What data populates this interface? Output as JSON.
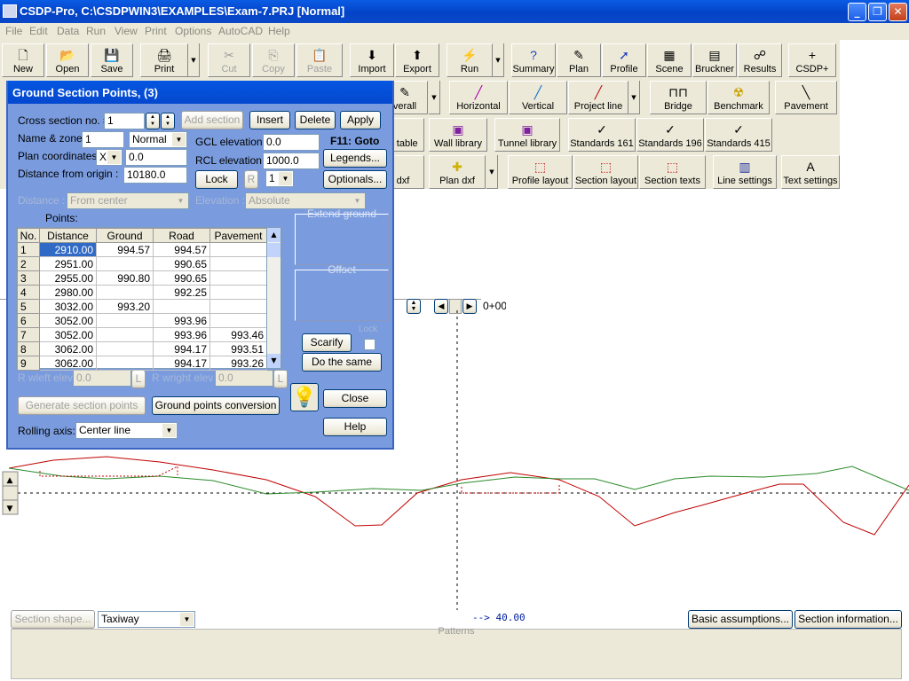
{
  "window": {
    "title": "CSDP-Pro, C:\\CSDPWIN3\\EXAMPLES\\Exam-7.PRJ [Normal]",
    "min": "_",
    "max": "❐",
    "close": "✕"
  },
  "menu": [
    "File",
    "Edit",
    "Data",
    "Run",
    "View",
    "Print",
    "Options",
    "AutoCAD",
    "Help"
  ],
  "toolbar1": [
    {
      "label": "New",
      "icon": "🗋"
    },
    {
      "label": "Open",
      "icon": "📂"
    },
    {
      "label": "Save",
      "icon": "💾"
    },
    {
      "label": "Print",
      "icon": "🖨"
    },
    {
      "label": "Cut",
      "icon": "✂"
    },
    {
      "label": "Copy",
      "icon": "⎘"
    },
    {
      "label": "Paste",
      "icon": "📋"
    },
    {
      "label": "Import",
      "icon": "⬇"
    },
    {
      "label": "Export",
      "icon": "⬆"
    },
    {
      "label": "Run",
      "icon": "⚡"
    },
    {
      "label": "Summary",
      "icon": "?"
    },
    {
      "label": "Plan",
      "icon": "✎"
    },
    {
      "label": "Profile",
      "icon": "➚"
    },
    {
      "label": "Scene",
      "icon": "▦"
    },
    {
      "label": "Bruckner",
      "icon": "▤"
    },
    {
      "label": "Results",
      "icon": "☍"
    },
    {
      "label": "CSDP+",
      "icon": "+"
    }
  ],
  "toolbar2": [
    {
      "label": "verall",
      "icon": "✎"
    },
    {
      "label": "Horizontal",
      "icon": "╱"
    },
    {
      "label": "Vertical",
      "icon": "╱"
    },
    {
      "label": "Project line",
      "icon": "╱"
    },
    {
      "label": "Bridge",
      "icon": "⊓⊓"
    },
    {
      "label": "Benchmark",
      "icon": "☢"
    },
    {
      "label": "Pavement",
      "icon": "╲"
    }
  ],
  "toolbar3": [
    {
      "label": "< table",
      "icon": ""
    },
    {
      "label": "Wall library",
      "icon": "▣"
    },
    {
      "label": "Tunnel library",
      "icon": "▣"
    },
    {
      "label": "Standards 161",
      "icon": "✓"
    },
    {
      "label": "Standards 196",
      "icon": "✓"
    },
    {
      "label": "Standards 415",
      "icon": "✓"
    }
  ],
  "toolbar4": [
    {
      "label": "dxf",
      "icon": ""
    },
    {
      "label": "Plan dxf",
      "icon": "✚"
    },
    {
      "label": "Profile layout",
      "icon": "⬚"
    },
    {
      "label": "Section layout",
      "icon": "⬚"
    },
    {
      "label": "Section texts",
      "icon": "⬚"
    },
    {
      "label": "Line settings",
      "icon": "▥"
    },
    {
      "label": "Text settings",
      "icon": "A"
    }
  ],
  "dialog": {
    "title": "Ground Section Points, (3)",
    "cross_section_label": "Cross section no. #",
    "cross_section_value": "1",
    "add_section": "Add section",
    "insert": "Insert",
    "delete": "Delete",
    "apply": "Apply",
    "name_zone_label": "Name & zone:",
    "name_value": "1",
    "zone_value": "Normal",
    "gcl_label": "GCL elevation :",
    "gcl_value": "0.0",
    "f11": "F11: Goto",
    "plan_coord_label": "Plan coordinates:",
    "plan_axis": "X",
    "plan_value": "0.0",
    "rcl_label": "RCL elevation :",
    "rcl_value": "1000.0",
    "legends": "Legends...",
    "distance_origin_label": "Distance from origin :",
    "distance_origin_value": "10180.0",
    "lock": "Lock",
    "r_btn": "R",
    "r_select": "1",
    "optionals": "Optionals...",
    "distance_label": "Distance :",
    "distance_select": "From center",
    "elevation_label": "Elevation :",
    "elevation_select": "Absolute",
    "points_label": "Points:",
    "columns": [
      "No.",
      "Distance",
      "Ground",
      "Road",
      "Pavement"
    ],
    "rows": [
      [
        "1",
        "2910.00",
        "994.57",
        "994.57",
        ""
      ],
      [
        "2",
        "2951.00",
        "",
        "990.65",
        ""
      ],
      [
        "3",
        "2955.00",
        "990.80",
        "990.65",
        ""
      ],
      [
        "4",
        "2980.00",
        "",
        "992.25",
        ""
      ],
      [
        "5",
        "3032.00",
        "993.20",
        "",
        ""
      ],
      [
        "6",
        "3052.00",
        "",
        "993.96",
        ""
      ],
      [
        "7",
        "3052.00",
        "",
        "993.96",
        "993.46"
      ],
      [
        "8",
        "3062.00",
        "",
        "994.17",
        "993.51"
      ],
      [
        "9",
        "3062.00",
        "",
        "994.17",
        "993.26"
      ]
    ],
    "extend_ground": "Extend ground",
    "offset": "Offset",
    "scarify": "Scarify",
    "lock2": "Lock",
    "do_same": "Do the same",
    "rwleft_label": "R wleft elev :",
    "rwleft_value": "0.0",
    "rwright_label": "R wright elev :",
    "rwright_value": "0.0",
    "l_btn": "L",
    "generate": "Generate section points",
    "ground_conversion": "Ground points conversion",
    "close": "Close",
    "help": "Help",
    "rolling_label": "Rolling axis:",
    "rolling_value": "Center line"
  },
  "nav": {
    "station": "0+00"
  },
  "chart": {
    "offset_label": "--> 40.00"
  },
  "bottom": {
    "section_shape": "Section shape...",
    "shape_value": "Taxiway",
    "basic": "Basic assumptions...",
    "section_info": "Section information...",
    "patterns": "Patterns"
  }
}
